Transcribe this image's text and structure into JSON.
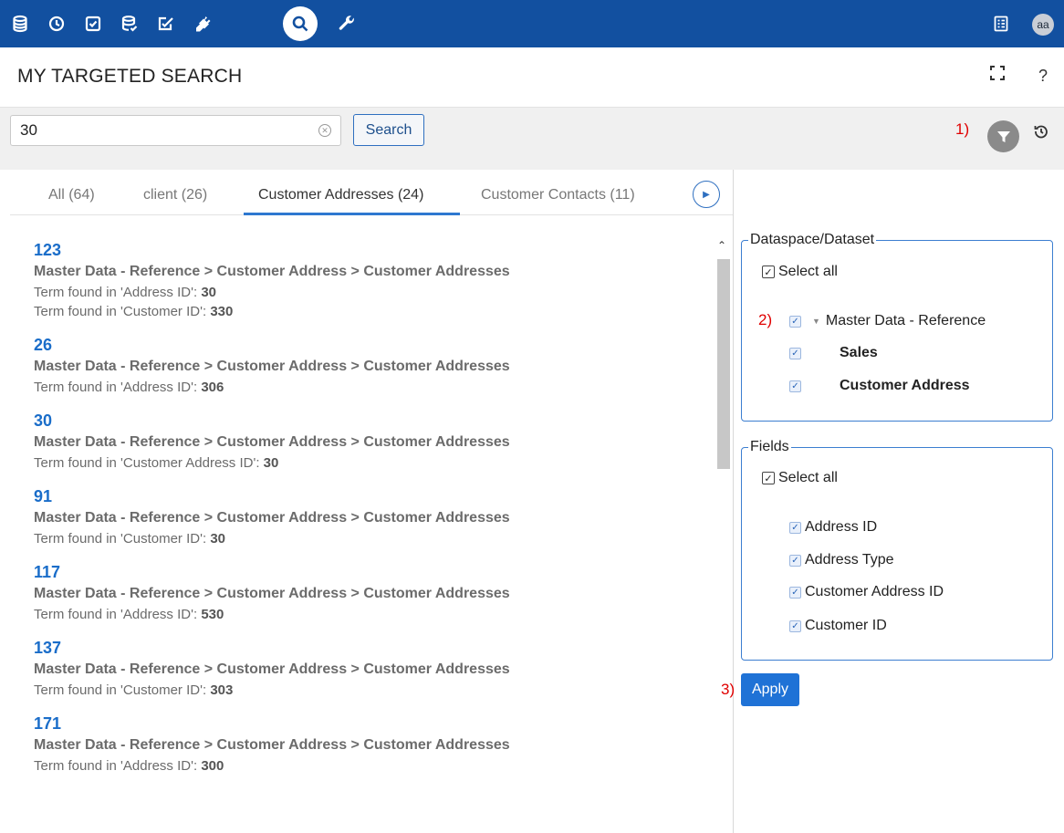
{
  "topbar": {
    "nav_icons": [
      "database-icon",
      "clock-icon",
      "checklist-icon",
      "database-check-icon",
      "task-edit-icon",
      "plug-icon",
      "search-icon",
      "wrench-icon"
    ],
    "active_icon": "search-icon",
    "right_icon": "list-view-icon",
    "avatar_initials": "aa",
    "bar_color": "#1250a0"
  },
  "header": {
    "title": "MY TARGETED SEARCH",
    "fullscreen_label": "⛶",
    "help_label": "?"
  },
  "search": {
    "value": "30",
    "placeholder": "",
    "button_label": "Search"
  },
  "annotations": {
    "marker_1": "1)",
    "marker_2": "2)",
    "marker_3": "3)"
  },
  "tabs": [
    {
      "label": "All (64)",
      "active": false
    },
    {
      "label": "client (26)",
      "active": false
    },
    {
      "label": "Customer Addresses (24)",
      "active": true
    },
    {
      "label": "Customer Contacts (11)",
      "active": false
    }
  ],
  "results": [
    {
      "id": "123",
      "path": "Master Data - Reference > Customer Address > Customer Addresses",
      "terms": [
        {
          "label": "Term found in 'Address ID':",
          "value": "30"
        },
        {
          "label": "Term found in 'Customer ID':",
          "value": "330"
        }
      ]
    },
    {
      "id": "26",
      "path": "Master Data - Reference > Customer Address > Customer Addresses",
      "terms": [
        {
          "label": "Term found in 'Address ID':",
          "value": "306"
        }
      ]
    },
    {
      "id": "30",
      "path": "Master Data - Reference > Customer Address > Customer Addresses",
      "terms": [
        {
          "label": "Term found in 'Customer Address ID':",
          "value": "30"
        }
      ]
    },
    {
      "id": "91",
      "path": "Master Data - Reference > Customer Address > Customer Addresses",
      "terms": [
        {
          "label": "Term found in 'Customer ID':",
          "value": "30"
        }
      ]
    },
    {
      "id": "117",
      "path": "Master Data - Reference > Customer Address > Customer Addresses",
      "terms": [
        {
          "label": "Term found in 'Address ID':",
          "value": "530"
        }
      ]
    },
    {
      "id": "137",
      "path": "Master Data - Reference > Customer Address > Customer Addresses",
      "terms": [
        {
          "label": "Term found in 'Customer ID':",
          "value": "303"
        }
      ]
    },
    {
      "id": "171",
      "path": "Master Data - Reference > Customer Address > Customer Addresses",
      "terms": [
        {
          "label": "Term found in 'Address ID':",
          "value": "300"
        }
      ]
    }
  ],
  "filters": {
    "dataspace": {
      "legend": "Dataspace/Dataset",
      "select_all": "Select all",
      "parent": "Master Data - Reference",
      "children": [
        "Sales",
        "Customer Address"
      ]
    },
    "fields": {
      "legend": "Fields",
      "select_all": "Select all",
      "items": [
        "Address ID",
        "Address Type",
        "Customer Address ID",
        "Customer ID"
      ]
    },
    "apply_label": "Apply"
  }
}
